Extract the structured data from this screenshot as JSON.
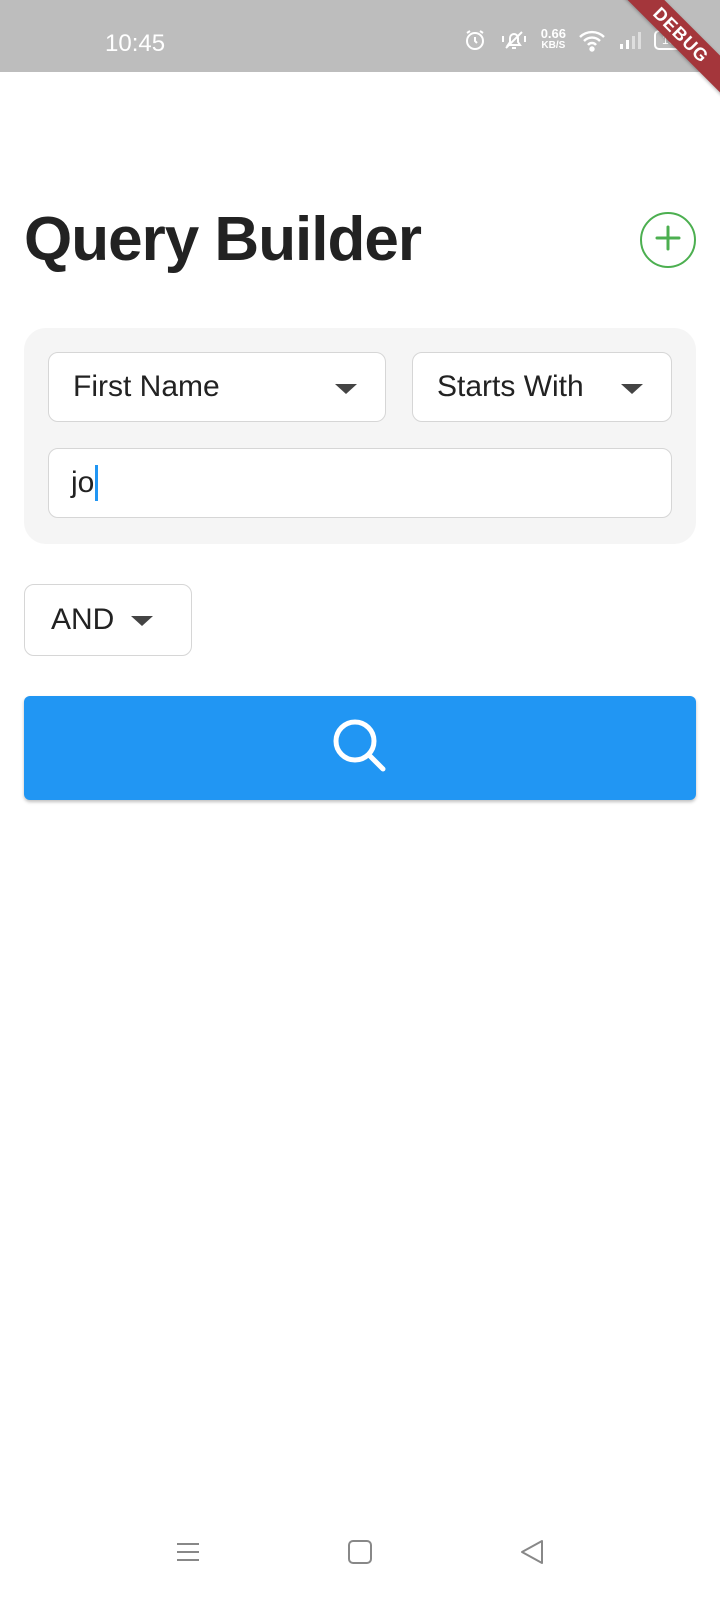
{
  "status_bar": {
    "time": "10:45",
    "net_speed": "0.66",
    "net_unit": "KB/S",
    "battery": "100",
    "icons": [
      "alarm-icon",
      "vibrate-icon",
      "wifi-icon",
      "signal-icon",
      "battery-icon"
    ]
  },
  "debug_banner": "DEBUG",
  "page": {
    "title": "Query Builder"
  },
  "condition": {
    "field": "First Name",
    "operator": "Starts With",
    "value": "jo"
  },
  "logic_operator": "AND",
  "colors": {
    "accent": "#2196f3",
    "add_button": "#4caf50",
    "debug_banner": "#a4363b",
    "status_bar": "#bdbdbd"
  }
}
